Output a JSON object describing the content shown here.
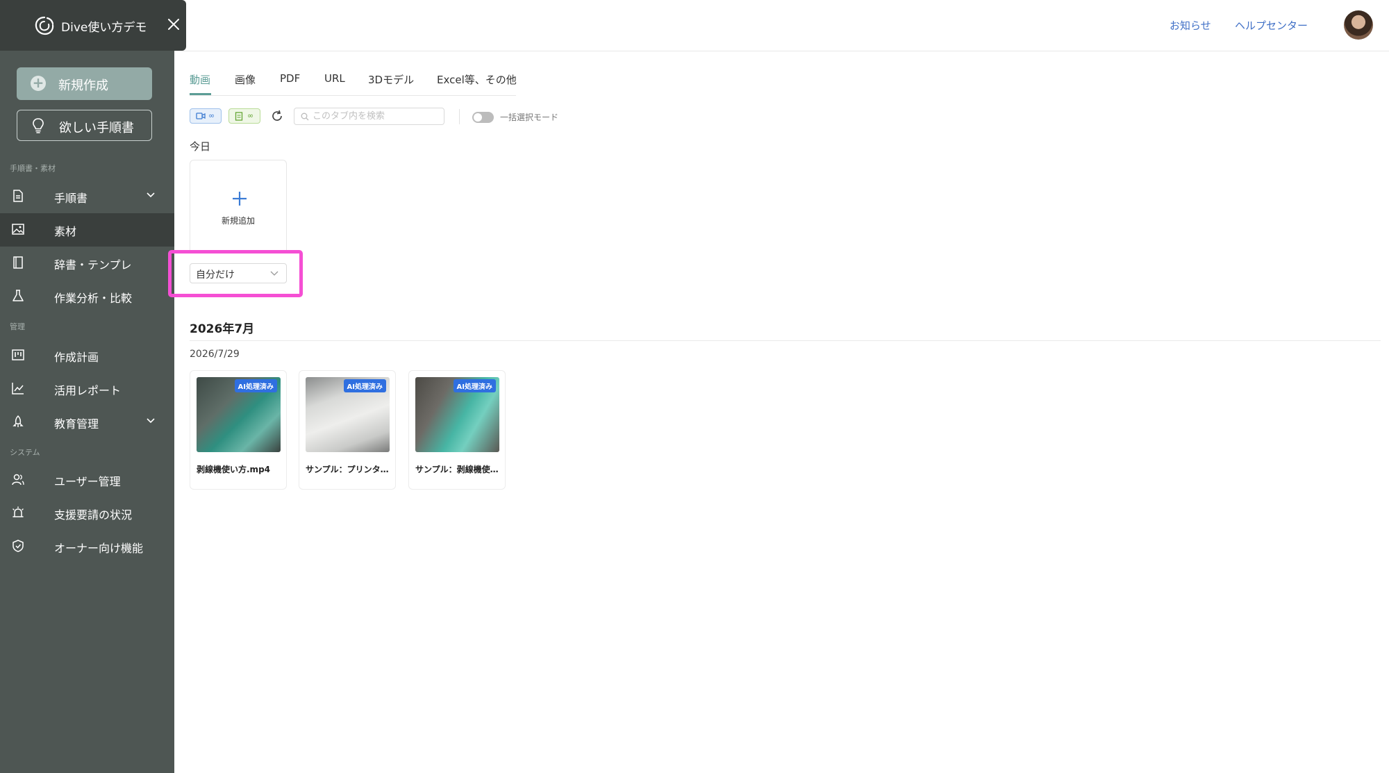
{
  "app": {
    "title": "Dive使い方デモ"
  },
  "sidebar": {
    "new_button": "新規作成",
    "want_button": "欲しい手順書",
    "sections": {
      "materials": "手順書・素材",
      "management": "管理",
      "system": "システム"
    },
    "items": [
      {
        "label": "手順書",
        "icon": "document-icon",
        "has_chevron": true
      },
      {
        "label": "素材",
        "icon": "image-icon",
        "active": true
      },
      {
        "label": "辞書・テンプレ",
        "icon": "book-icon"
      },
      {
        "label": "作業分析・比較",
        "icon": "flask-icon"
      },
      {
        "label": "作成計画",
        "icon": "kanban-icon"
      },
      {
        "label": "活用レポート",
        "icon": "line-chart-icon"
      },
      {
        "label": "教育管理",
        "icon": "rocket-icon",
        "has_chevron": true
      },
      {
        "label": "ユーザー管理",
        "icon": "users-icon"
      },
      {
        "label": "支援要請の状況",
        "icon": "alarm-icon"
      },
      {
        "label": "オーナー向け機能",
        "icon": "shield-icon"
      }
    ]
  },
  "header": {
    "notice": "お知らせ",
    "help": "ヘルプセンター"
  },
  "tabs": [
    {
      "label": "動画",
      "active": true
    },
    {
      "label": "画像"
    },
    {
      "label": "PDF"
    },
    {
      "label": "URL"
    },
    {
      "label": "3Dモデル"
    },
    {
      "label": "Excel等、その他"
    }
  ],
  "toolbar": {
    "video_count": "∞",
    "doc_count": "∞",
    "search_placeholder": "このタブ内を検索",
    "bulk_select_label": "一括選択モード"
  },
  "today": {
    "heading": "今日",
    "add_label": "新規追加",
    "filter_value": "自分だけ"
  },
  "group": {
    "month": "2026年7月",
    "day": "2026/7/29",
    "videos": [
      {
        "name": "剥線機使い方.mp4",
        "badge": "AI処理済み"
      },
      {
        "name": "サンプル：プリンター使い方",
        "badge": "AI処理済み"
      },
      {
        "name": "サンプル：剥線機使い方",
        "badge": "AI処理済み"
      }
    ]
  },
  "colors": {
    "sidebar_bg": "#4e5653",
    "accent": "#5c9d96",
    "link": "#3f6fc6",
    "badge": "#2f6fe0",
    "highlight": "#f54fd4"
  }
}
